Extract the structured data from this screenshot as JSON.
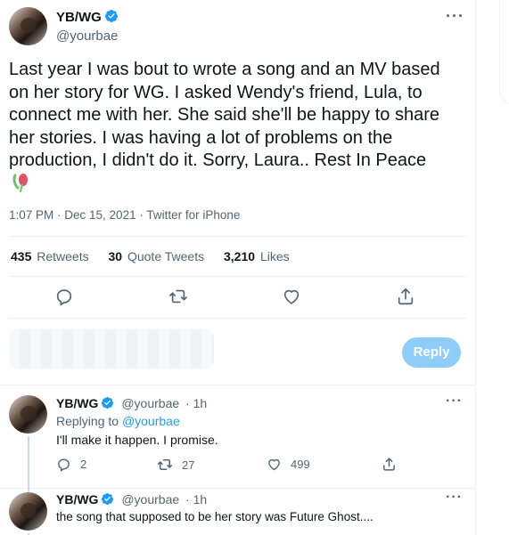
{
  "main_tweet": {
    "author_name": "YB/WG",
    "author_handle": "@yourbae",
    "text": "Last year I was bout to wrote a song and an MV based on her story for WG. I asked Wendy's friend, Lula, to connect me with her. She said she'll be happy to share her stories. I was having a lot of problems on the production, I didn't do it. Sorry, Laura.. Rest In Peace",
    "timestamp": "1:07 PM · Dec 15, 2021 · Twitter for iPhone",
    "retweets_count": "435",
    "retweets_label": "Retweets",
    "quotes_count": "30",
    "quotes_label": "Quote Tweets",
    "likes_count": "3,210",
    "likes_label": "Likes",
    "reply_button": "Reply"
  },
  "replies": [
    {
      "author_name": "YB/WG",
      "author_handle": "@yourbae",
      "time": "· 1h",
      "replying_prefix": "Replying to",
      "replying_handle": "@yourbae",
      "text": "I'll make it happen. I promise.",
      "reply_count": "2",
      "retweet_count": "27",
      "like_count": "499"
    },
    {
      "author_name": "YB/WG",
      "author_handle": "@yourbae",
      "time": "· 1h",
      "text": "the song that supposed to be her story was Future Ghost...."
    }
  ],
  "more_glyph": "···",
  "colors": {
    "accent": "#1d9bf0",
    "reply_button_disabled": "#8ecdf8",
    "secondary_text": "#536471",
    "divider": "#eff3f4"
  }
}
